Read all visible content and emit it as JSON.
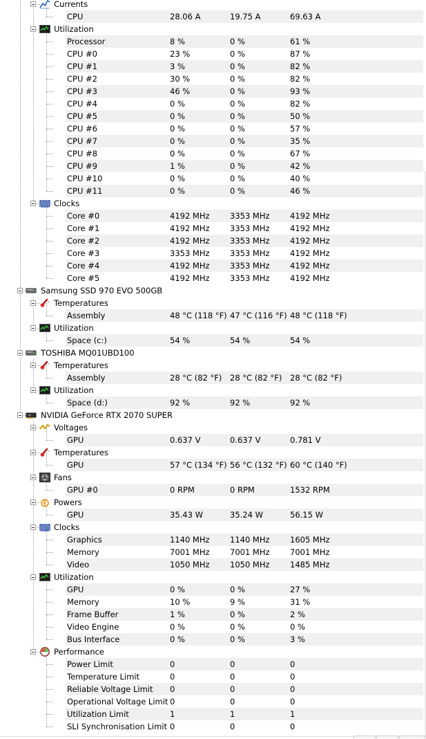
{
  "rows": [
    {
      "kind": "group",
      "level": 1,
      "label": "Currents",
      "icon": "current-icon"
    },
    {
      "kind": "sensor",
      "label": "CPU",
      "v": [
        "28.06 A",
        "19.75 A",
        "69.63 A"
      ]
    },
    {
      "kind": "group",
      "level": 1,
      "label": "Utilization",
      "icon": "utilization-icon"
    },
    {
      "kind": "sensor",
      "label": "Processor",
      "v": [
        "8 %",
        "0 %",
        "61 %"
      ]
    },
    {
      "kind": "sensor",
      "label": "CPU #0",
      "v": [
        "23 %",
        "0 %",
        "87 %"
      ]
    },
    {
      "kind": "sensor",
      "label": "CPU #1",
      "v": [
        "3 %",
        "0 %",
        "82 %"
      ]
    },
    {
      "kind": "sensor",
      "label": "CPU #2",
      "v": [
        "30 %",
        "0 %",
        "82 %"
      ]
    },
    {
      "kind": "sensor",
      "label": "CPU #3",
      "v": [
        "46 %",
        "0 %",
        "93 %"
      ]
    },
    {
      "kind": "sensor",
      "label": "CPU #4",
      "v": [
        "0 %",
        "0 %",
        "82 %"
      ]
    },
    {
      "kind": "sensor",
      "label": "CPU #5",
      "v": [
        "0 %",
        "0 %",
        "50 %"
      ]
    },
    {
      "kind": "sensor",
      "label": "CPU #6",
      "v": [
        "0 %",
        "0 %",
        "57 %"
      ]
    },
    {
      "kind": "sensor",
      "label": "CPU #7",
      "v": [
        "0 %",
        "0 %",
        "35 %"
      ]
    },
    {
      "kind": "sensor",
      "label": "CPU #8",
      "v": [
        "0 %",
        "0 %",
        "67 %"
      ]
    },
    {
      "kind": "sensor",
      "label": "CPU #9",
      "v": [
        "1 %",
        "0 %",
        "42 %"
      ]
    },
    {
      "kind": "sensor",
      "label": "CPU #10",
      "v": [
        "0 %",
        "0 %",
        "40 %"
      ]
    },
    {
      "kind": "sensor",
      "label": "CPU #11",
      "v": [
        "0 %",
        "0 %",
        "46 %"
      ]
    },
    {
      "kind": "group",
      "level": 1,
      "label": "Clocks",
      "icon": "clock-icon"
    },
    {
      "kind": "sensor",
      "label": "Core #0",
      "v": [
        "4192 MHz",
        "3353 MHz",
        "4192 MHz"
      ]
    },
    {
      "kind": "sensor",
      "label": "Core #1",
      "v": [
        "4192 MHz",
        "3353 MHz",
        "4192 MHz"
      ]
    },
    {
      "kind": "sensor",
      "label": "Core #2",
      "v": [
        "4192 MHz",
        "3353 MHz",
        "4192 MHz"
      ]
    },
    {
      "kind": "sensor",
      "label": "Core #3",
      "v": [
        "3353 MHz",
        "3353 MHz",
        "4192 MHz"
      ]
    },
    {
      "kind": "sensor",
      "label": "Core #4",
      "v": [
        "4192 MHz",
        "3353 MHz",
        "4192 MHz"
      ]
    },
    {
      "kind": "sensor",
      "label": "Core #5",
      "v": [
        "4192 MHz",
        "3353 MHz",
        "4192 MHz"
      ]
    },
    {
      "kind": "group",
      "level": 0,
      "label": "Samsung SSD 970 EVO 500GB",
      "icon": "drive-icon"
    },
    {
      "kind": "group",
      "level": 1,
      "label": "Temperatures",
      "icon": "thermometer-icon"
    },
    {
      "kind": "sensor",
      "label": "Assembly",
      "v": [
        "48 °C  (118 °F)",
        "47 °C  (116 °F)",
        "48 °C  (118 °F)"
      ]
    },
    {
      "kind": "group",
      "level": 1,
      "label": "Utilization",
      "icon": "utilization-icon"
    },
    {
      "kind": "sensor",
      "label": "Space (c:)",
      "v": [
        "54 %",
        "54 %",
        "54 %"
      ]
    },
    {
      "kind": "group",
      "level": 0,
      "label": "TOSHIBA MQ01UBD100",
      "icon": "drive-icon"
    },
    {
      "kind": "group",
      "level": 1,
      "label": "Temperatures",
      "icon": "thermometer-icon"
    },
    {
      "kind": "sensor",
      "label": "Assembly",
      "v": [
        "28 °C  (82 °F)",
        "28 °C  (82 °F)",
        "28 °C  (82 °F)"
      ]
    },
    {
      "kind": "group",
      "level": 1,
      "label": "Utilization",
      "icon": "utilization-icon"
    },
    {
      "kind": "sensor",
      "label": "Space (d:)",
      "v": [
        "92 %",
        "92 %",
        "92 %"
      ]
    },
    {
      "kind": "group",
      "level": 0,
      "label": "NVIDIA GeForce RTX 2070 SUPER",
      "icon": "gpu-icon"
    },
    {
      "kind": "group",
      "level": 1,
      "label": "Voltages",
      "icon": "voltage-icon"
    },
    {
      "kind": "sensor",
      "label": "GPU",
      "v": [
        "0.637 V",
        "0.637 V",
        "0.781 V"
      ]
    },
    {
      "kind": "group",
      "level": 1,
      "label": "Temperatures",
      "icon": "thermometer-icon"
    },
    {
      "kind": "sensor",
      "label": "GPU",
      "v": [
        "57 °C  (134 °F)",
        "56 °C  (132 °F)",
        "60 °C  (140 °F)"
      ]
    },
    {
      "kind": "group",
      "level": 1,
      "label": "Fans",
      "icon": "fan-icon"
    },
    {
      "kind": "sensor",
      "label": "GPU #0",
      "v": [
        "0 RPM",
        "0 RPM",
        "1532 RPM"
      ]
    },
    {
      "kind": "group",
      "level": 1,
      "label": "Powers",
      "icon": "power-icon"
    },
    {
      "kind": "sensor",
      "label": "GPU",
      "v": [
        "35.43 W",
        "35.24 W",
        "56.15 W"
      ]
    },
    {
      "kind": "group",
      "level": 1,
      "label": "Clocks",
      "icon": "clock-icon"
    },
    {
      "kind": "sensor",
      "label": "Graphics",
      "v": [
        "1140 MHz",
        "1140 MHz",
        "1605 MHz"
      ]
    },
    {
      "kind": "sensor",
      "label": "Memory",
      "v": [
        "7001 MHz",
        "7001 MHz",
        "7001 MHz"
      ]
    },
    {
      "kind": "sensor",
      "label": "Video",
      "v": [
        "1050 MHz",
        "1050 MHz",
        "1485 MHz"
      ]
    },
    {
      "kind": "group",
      "level": 1,
      "label": "Utilization",
      "icon": "utilization-icon"
    },
    {
      "kind": "sensor",
      "label": "GPU",
      "v": [
        "0 %",
        "0 %",
        "27 %"
      ]
    },
    {
      "kind": "sensor",
      "label": "Memory",
      "v": [
        "10 %",
        "9 %",
        "31 %"
      ]
    },
    {
      "kind": "sensor",
      "label": "Frame Buffer",
      "v": [
        "1 %",
        "0 %",
        "2 %"
      ]
    },
    {
      "kind": "sensor",
      "label": "Video Engine",
      "v": [
        "0 %",
        "0 %",
        "0 %"
      ]
    },
    {
      "kind": "sensor",
      "label": "Bus Interface",
      "v": [
        "0 %",
        "0 %",
        "3 %"
      ]
    },
    {
      "kind": "group",
      "level": 1,
      "label": "Performance",
      "icon": "performance-icon"
    },
    {
      "kind": "sensor",
      "label": "Power Limit",
      "v": [
        "0",
        "0",
        "0"
      ]
    },
    {
      "kind": "sensor",
      "label": "Temperature Limit",
      "v": [
        "0",
        "0",
        "0"
      ]
    },
    {
      "kind": "sensor",
      "label": "Reliable Voltage Limit",
      "v": [
        "0",
        "0",
        "0"
      ]
    },
    {
      "kind": "sensor",
      "label": "Operational Voltage Limit",
      "v": [
        "0",
        "0",
        "0"
      ]
    },
    {
      "kind": "sensor",
      "label": "Utilization Limit",
      "v": [
        "1",
        "1",
        "1"
      ]
    },
    {
      "kind": "sensor",
      "label": "SLI Synchronisation Limit",
      "v": [
        "0",
        "0",
        "0"
      ]
    }
  ]
}
